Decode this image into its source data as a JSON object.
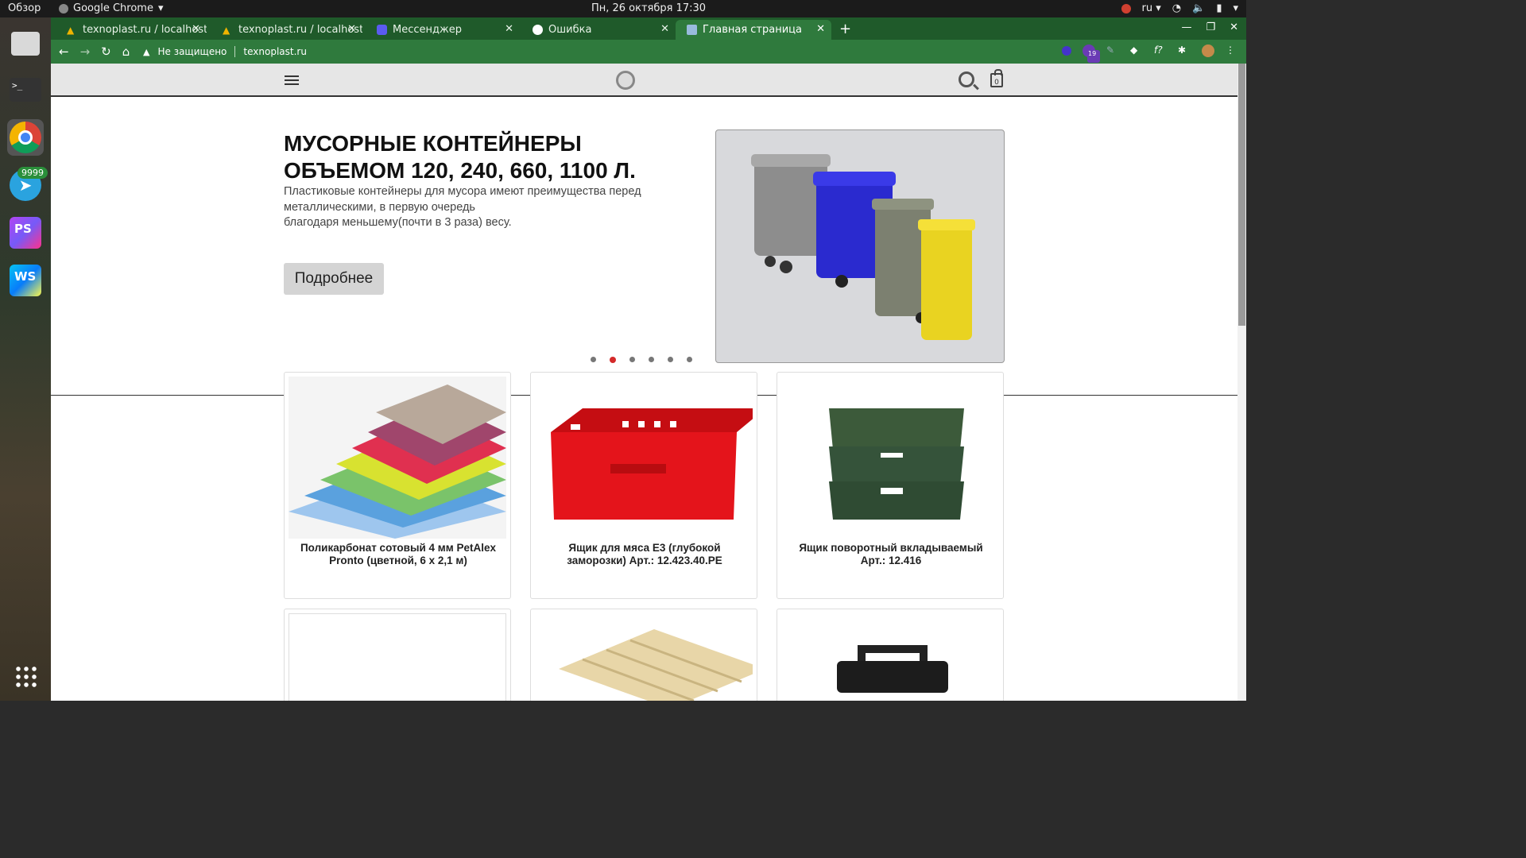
{
  "system": {
    "overview": "Обзор",
    "app_name": "Google Chrome",
    "clock": "Пн, 26 октября  17:30",
    "lang": "ru"
  },
  "dock": {
    "telegram_badge": "9999"
  },
  "tabs": [
    {
      "label": "texnoplast.ru / localhost"
    },
    {
      "label": "texnoplast.ru / localhost"
    },
    {
      "label": "Мессенджер"
    },
    {
      "label": "Ошибка"
    },
    {
      "label": "Главная страница"
    }
  ],
  "toolbar": {
    "security": "Не защищено",
    "url": "texnoplast.ru",
    "ext_badge": "19"
  },
  "header": {
    "cart_count": "0"
  },
  "hero": {
    "title": "МУСОРНЫЕ КОНТЕЙНЕРЫ ОБЪЕМОМ 120, 240, 660, 1100 Л.",
    "desc_line1": "Пластиковые контейнеры для мусора имеют преимущества перед",
    "desc_line2": "металлическими, в первую очередь",
    "desc_line3": "благодаря меньшему(почти в 3 раза) весу.",
    "button": "Подробнее",
    "slides": 6,
    "active_slide": 2
  },
  "products": [
    {
      "name": "Поликарбонат сотовый 4 мм PetAlex Pronto (цветной, 6 х 2,1 м)"
    },
    {
      "name": "Ящик для мяса Е3 (глубокой заморозки) Арт.: 12.423.40.РЕ"
    },
    {
      "name": "Ящик поворотный вкладываемый Арт.: 12.416"
    }
  ]
}
